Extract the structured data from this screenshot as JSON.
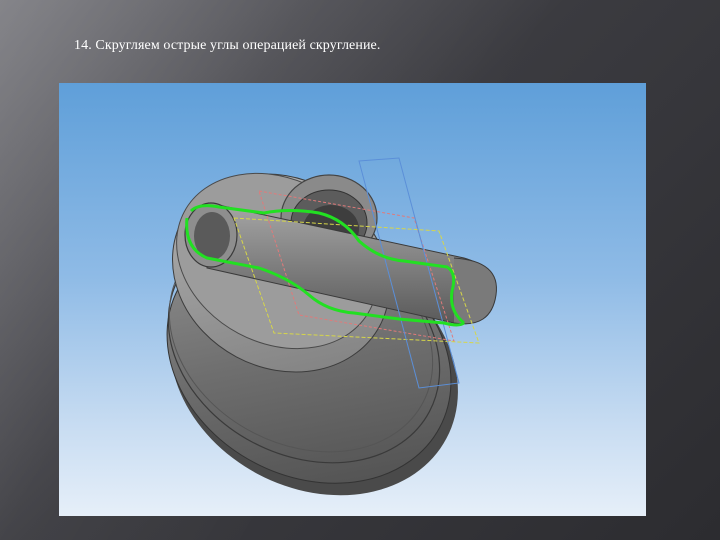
{
  "slide": {
    "caption": "14. Скругляем острые углы операцией скругление."
  },
  "viewport": {
    "background_top": "#5f9fd9",
    "background_bottom": "#e6eff9",
    "model_icon": "3d-part-icon",
    "highlight_color": "#22e022",
    "sketch_colors": [
      "#e07a7a",
      "#d6d64a",
      "#5b8fd8"
    ]
  }
}
